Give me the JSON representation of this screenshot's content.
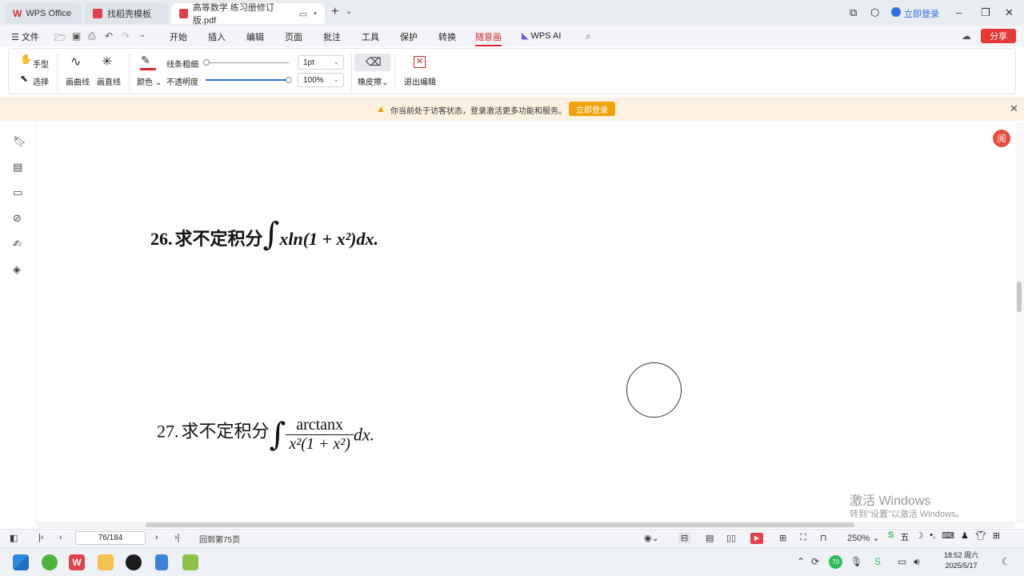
{
  "tabs": [
    {
      "label": "WPS Office"
    },
    {
      "label": "找稻壳模板"
    },
    {
      "label": "高等数学 练习册修订版.pdf"
    }
  ],
  "window": {
    "login": "立即登录"
  },
  "menu": {
    "file": "文件",
    "items": [
      "开始",
      "插入",
      "编辑",
      "页面",
      "批注",
      "工具",
      "保护",
      "转换",
      "随意画",
      "WPS AI"
    ],
    "active": "随意画",
    "share": "分享"
  },
  "ribbon": {
    "hand": "手型",
    "select": "选择",
    "curve": "画曲线",
    "line": "画直线",
    "color": "颜色",
    "thickness_label": "线条粗细",
    "thickness_value": "1pt",
    "opacity_label": "不透明度",
    "opacity_value": "100%",
    "eraser": "橡皮擦",
    "exit": "退出编辑"
  },
  "notice": {
    "text": "你当前处于访客状态，登录激活更多功能和服务。",
    "button": "立即登录"
  },
  "document": {
    "q26_num": "26.",
    "q26_text": "求不定积分",
    "q26_expr": "xln(1 + x²)dx.",
    "q27_num": "27.",
    "q27_text": "求不定积分",
    "q27_numerator": "arctanx",
    "q27_denominator": "x²(1 + x²)",
    "q27_tail": "dx.",
    "badge": "阅"
  },
  "watermark": {
    "line1": "激活 Windows",
    "line2": "转到\"设置\"以激活 Windows。"
  },
  "status": {
    "page": "76/184",
    "back": "回到第75页",
    "zoom": "250%"
  },
  "taskbar": {
    "time": "18:52 周六",
    "date": "2025/5/17",
    "ime": "五",
    "notif_count": "70"
  },
  "colors": {
    "accent": "#d9262b",
    "notice_bg": "#fdf2e2",
    "login_button": "#f2a20c"
  }
}
